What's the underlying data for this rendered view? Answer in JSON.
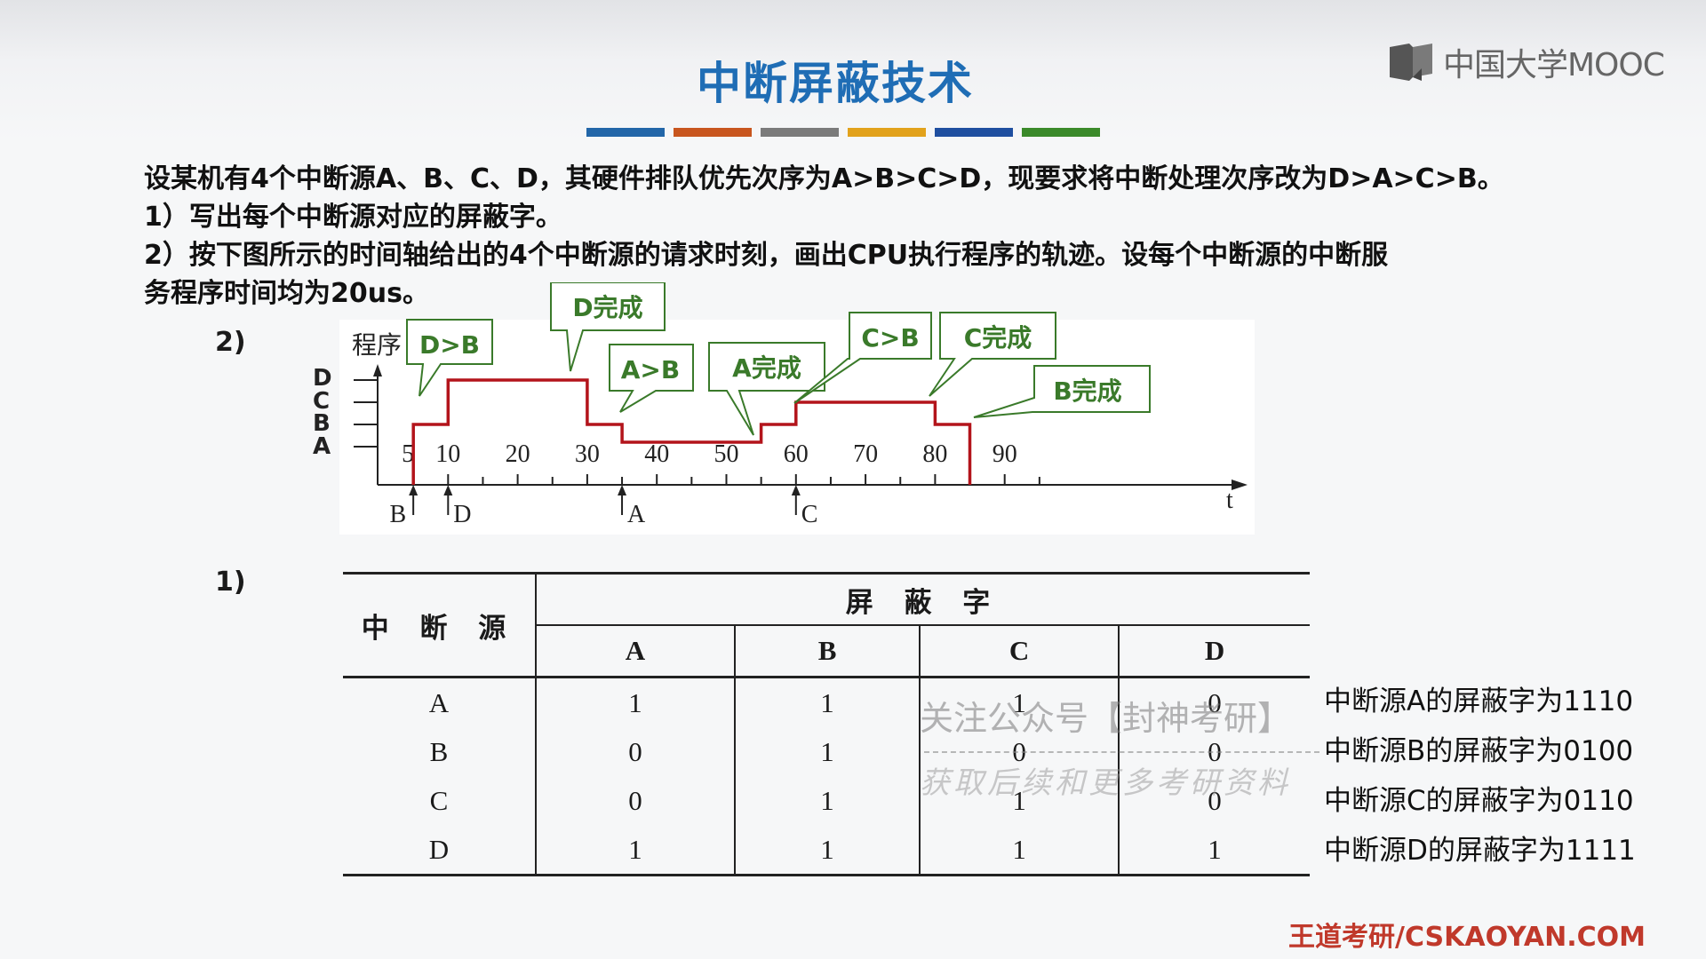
{
  "title": "中断屏蔽技术",
  "logo": {
    "text": "中国大学MOOC",
    "icon": "book-icon"
  },
  "accent_colors": [
    "#2266a8",
    "#c8561e",
    "#7b7b7b",
    "#e2a21c",
    "#1f4fa0",
    "#3b8a2a"
  ],
  "problem": {
    "intro": "设某机有4个中断源A、B、C、D，其硬件排队优先次序为A>B>C>D，现要求将中断处理次序改为D>A>C>B。",
    "q1": "1）写出每个中断源对应的屏蔽字。",
    "q2_line1": "2）按下图所示的时间轴给出的4个中断源的请求时刻，画出CPU执行程序的轨迹。设每个中断源的中断服",
    "q2_line2": "务程序时间均为20us。"
  },
  "section_labels": {
    "part2": "2)",
    "part1": "1)"
  },
  "diagram": {
    "y_label": "程序",
    "x_label": "t",
    "levels": [
      "D",
      "C",
      "B",
      "A"
    ],
    "ticks": [
      "5",
      "10",
      "20",
      "30",
      "40",
      "50",
      "60",
      "70",
      "80",
      "90"
    ],
    "requests": [
      {
        "label": "B",
        "time": 5
      },
      {
        "label": "D",
        "time": 10
      },
      {
        "label": "A",
        "time": 35
      },
      {
        "label": "C",
        "time": 60
      }
    ],
    "callouts": {
      "d_gt_b": "D>B",
      "d_done": "D完成",
      "a_gt_b": "A>B",
      "a_done": "A完成",
      "c_gt_b": "C>B",
      "c_done": "C完成",
      "b_done": "B完成"
    },
    "trace_color": "#b3141b",
    "callout_color": "#3a7a2a"
  },
  "table": {
    "source_header": "中 断 源",
    "mask_header": "屏 蔽 字",
    "columns": [
      "A",
      "B",
      "C",
      "D"
    ],
    "rows": [
      {
        "source": "A",
        "values": [
          "1",
          "1",
          "1",
          "0"
        ]
      },
      {
        "source": "B",
        "values": [
          "0",
          "1",
          "0",
          "0"
        ]
      },
      {
        "source": "C",
        "values": [
          "0",
          "1",
          "1",
          "0"
        ]
      },
      {
        "source": "D",
        "values": [
          "1",
          "1",
          "1",
          "1"
        ]
      }
    ]
  },
  "results": [
    "中断源A的屏蔽字为1110",
    "中断源B的屏蔽字为0100",
    "中断源C的屏蔽字为0110",
    "中断源D的屏蔽字为1111"
  ],
  "watermark": {
    "line1": "关注公众号【封神考研】",
    "line2": "获取后续和更多考研资料"
  },
  "footer": "王道考研/CSKAOYAN.COM"
}
